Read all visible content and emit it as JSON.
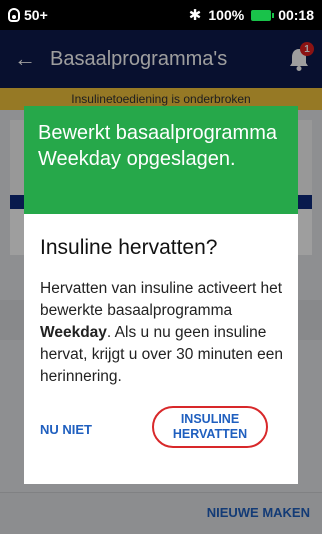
{
  "status_bar": {
    "pod_level": "50+",
    "battery_percent": "100%",
    "time": "00:18",
    "battery_color": "#19c24a"
  },
  "header": {
    "title": "Basaalprogramma's",
    "notification_count": "1",
    "background_color": "#0d1a4d"
  },
  "background": {
    "banner_text": "Insulinetoediening is onderbroken",
    "new_button_label": "NIEUWE MAKEN"
  },
  "dialog": {
    "toast_text": "Bewerkt basaalprogramma Weekday opgeslagen.",
    "toast_color": "#26a84a",
    "title": "Insuline hervatten?",
    "body_before": "Hervatten van insuline activeert het bewerkte basaalprogramma ",
    "body_program": "Weekday",
    "body_after": ". Als u nu geen insuline hervat, krijgt u over 30 minuten een herinnering.",
    "not_now_label": "NU NIET",
    "resume_label": "INSULINE HERVATTEN"
  }
}
